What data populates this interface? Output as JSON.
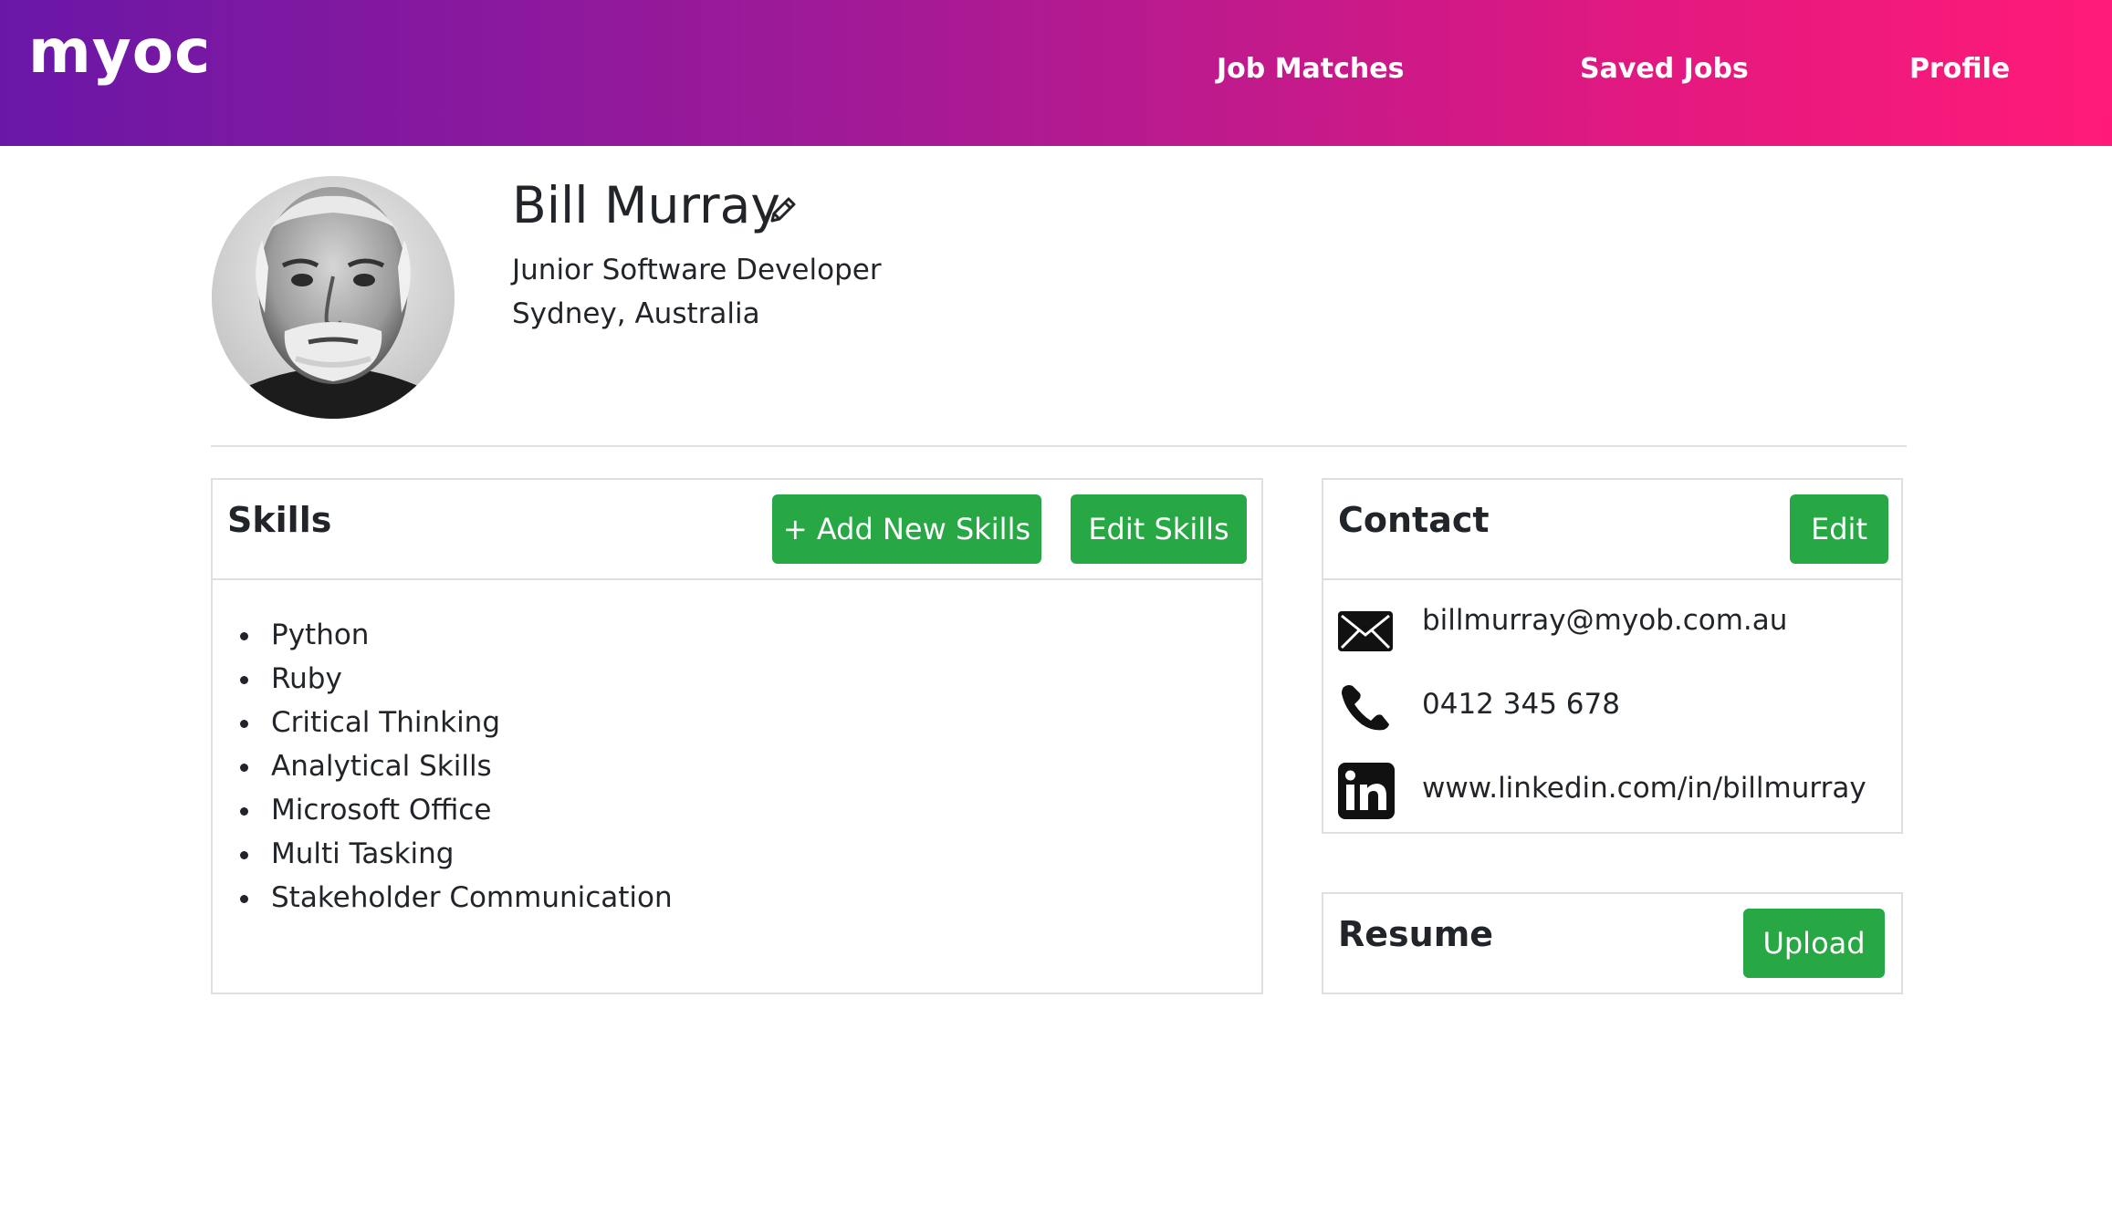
{
  "brand": {
    "logo_text": "myoc"
  },
  "nav": {
    "job_matches": "Job Matches",
    "saved_jobs": "Saved Jobs",
    "profile": "Profile"
  },
  "profile": {
    "name": "Bill Murray",
    "title": "Junior Software Developer",
    "location": "Sydney, Australia",
    "edit_icon": "pencil-icon"
  },
  "skills": {
    "heading": "Skills",
    "add_button": "+ Add New Skills",
    "edit_button": "Edit Skills",
    "items": [
      "Python",
      "Ruby",
      "Critical Thinking",
      "Analytical Skills",
      "Microsoft Office",
      "Multi Tasking",
      "Stakeholder Communication"
    ]
  },
  "contact": {
    "heading": "Contact",
    "edit_button": "Edit",
    "email": "billmurray@myob.com.au",
    "phone": "0412 345 678",
    "linkedin": "www.linkedin.com/in/billmurray",
    "icons": [
      "envelope-icon",
      "phone-icon",
      "linkedin-icon"
    ]
  },
  "resume": {
    "heading": "Resume",
    "upload_button": "Upload"
  },
  "colors": {
    "header_gradient_start": "#6a17a7",
    "header_gradient_end": "#ff1a78",
    "button_green": "#28a745",
    "border": "#dfdfdf"
  }
}
